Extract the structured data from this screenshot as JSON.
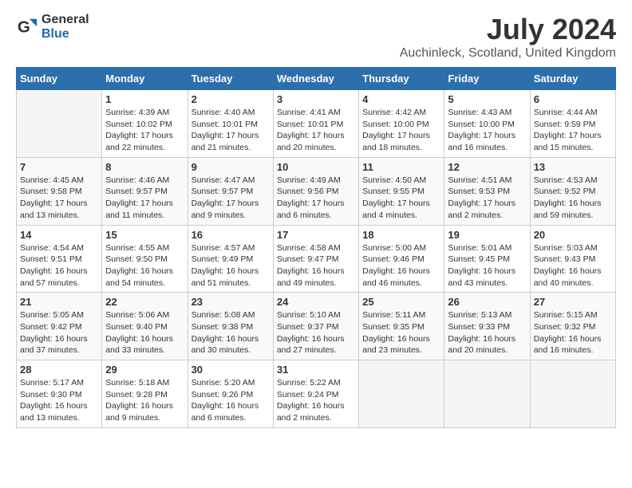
{
  "header": {
    "logo_general": "General",
    "logo_blue": "Blue",
    "title": "July 2024",
    "subtitle": "Auchinleck, Scotland, United Kingdom"
  },
  "calendar": {
    "days_of_week": [
      "Sunday",
      "Monday",
      "Tuesday",
      "Wednesday",
      "Thursday",
      "Friday",
      "Saturday"
    ],
    "weeks": [
      [
        {
          "day": "",
          "content": ""
        },
        {
          "day": "1",
          "content": "Sunrise: 4:39 AM\nSunset: 10:02 PM\nDaylight: 17 hours\nand 22 minutes."
        },
        {
          "day": "2",
          "content": "Sunrise: 4:40 AM\nSunset: 10:01 PM\nDaylight: 17 hours\nand 21 minutes."
        },
        {
          "day": "3",
          "content": "Sunrise: 4:41 AM\nSunset: 10:01 PM\nDaylight: 17 hours\nand 20 minutes."
        },
        {
          "day": "4",
          "content": "Sunrise: 4:42 AM\nSunset: 10:00 PM\nDaylight: 17 hours\nand 18 minutes."
        },
        {
          "day": "5",
          "content": "Sunrise: 4:43 AM\nSunset: 10:00 PM\nDaylight: 17 hours\nand 16 minutes."
        },
        {
          "day": "6",
          "content": "Sunrise: 4:44 AM\nSunset: 9:59 PM\nDaylight: 17 hours\nand 15 minutes."
        }
      ],
      [
        {
          "day": "7",
          "content": "Sunrise: 4:45 AM\nSunset: 9:58 PM\nDaylight: 17 hours\nand 13 minutes."
        },
        {
          "day": "8",
          "content": "Sunrise: 4:46 AM\nSunset: 9:57 PM\nDaylight: 17 hours\nand 11 minutes."
        },
        {
          "day": "9",
          "content": "Sunrise: 4:47 AM\nSunset: 9:57 PM\nDaylight: 17 hours\nand 9 minutes."
        },
        {
          "day": "10",
          "content": "Sunrise: 4:49 AM\nSunset: 9:56 PM\nDaylight: 17 hours\nand 6 minutes."
        },
        {
          "day": "11",
          "content": "Sunrise: 4:50 AM\nSunset: 9:55 PM\nDaylight: 17 hours\nand 4 minutes."
        },
        {
          "day": "12",
          "content": "Sunrise: 4:51 AM\nSunset: 9:53 PM\nDaylight: 17 hours\nand 2 minutes."
        },
        {
          "day": "13",
          "content": "Sunrise: 4:53 AM\nSunset: 9:52 PM\nDaylight: 16 hours\nand 59 minutes."
        }
      ],
      [
        {
          "day": "14",
          "content": "Sunrise: 4:54 AM\nSunset: 9:51 PM\nDaylight: 16 hours\nand 57 minutes."
        },
        {
          "day": "15",
          "content": "Sunrise: 4:55 AM\nSunset: 9:50 PM\nDaylight: 16 hours\nand 54 minutes."
        },
        {
          "day": "16",
          "content": "Sunrise: 4:57 AM\nSunset: 9:49 PM\nDaylight: 16 hours\nand 51 minutes."
        },
        {
          "day": "17",
          "content": "Sunrise: 4:58 AM\nSunset: 9:47 PM\nDaylight: 16 hours\nand 49 minutes."
        },
        {
          "day": "18",
          "content": "Sunrise: 5:00 AM\nSunset: 9:46 PM\nDaylight: 16 hours\nand 46 minutes."
        },
        {
          "day": "19",
          "content": "Sunrise: 5:01 AM\nSunset: 9:45 PM\nDaylight: 16 hours\nand 43 minutes."
        },
        {
          "day": "20",
          "content": "Sunrise: 5:03 AM\nSunset: 9:43 PM\nDaylight: 16 hours\nand 40 minutes."
        }
      ],
      [
        {
          "day": "21",
          "content": "Sunrise: 5:05 AM\nSunset: 9:42 PM\nDaylight: 16 hours\nand 37 minutes."
        },
        {
          "day": "22",
          "content": "Sunrise: 5:06 AM\nSunset: 9:40 PM\nDaylight: 16 hours\nand 33 minutes."
        },
        {
          "day": "23",
          "content": "Sunrise: 5:08 AM\nSunset: 9:38 PM\nDaylight: 16 hours\nand 30 minutes."
        },
        {
          "day": "24",
          "content": "Sunrise: 5:10 AM\nSunset: 9:37 PM\nDaylight: 16 hours\nand 27 minutes."
        },
        {
          "day": "25",
          "content": "Sunrise: 5:11 AM\nSunset: 9:35 PM\nDaylight: 16 hours\nand 23 minutes."
        },
        {
          "day": "26",
          "content": "Sunrise: 5:13 AM\nSunset: 9:33 PM\nDaylight: 16 hours\nand 20 minutes."
        },
        {
          "day": "27",
          "content": "Sunrise: 5:15 AM\nSunset: 9:32 PM\nDaylight: 16 hours\nand 16 minutes."
        }
      ],
      [
        {
          "day": "28",
          "content": "Sunrise: 5:17 AM\nSunset: 9:30 PM\nDaylight: 16 hours\nand 13 minutes."
        },
        {
          "day": "29",
          "content": "Sunrise: 5:18 AM\nSunset: 9:28 PM\nDaylight: 16 hours\nand 9 minutes."
        },
        {
          "day": "30",
          "content": "Sunrise: 5:20 AM\nSunset: 9:26 PM\nDaylight: 16 hours\nand 6 minutes."
        },
        {
          "day": "31",
          "content": "Sunrise: 5:22 AM\nSunset: 9:24 PM\nDaylight: 16 hours\nand 2 minutes."
        },
        {
          "day": "",
          "content": ""
        },
        {
          "day": "",
          "content": ""
        },
        {
          "day": "",
          "content": ""
        }
      ]
    ]
  }
}
